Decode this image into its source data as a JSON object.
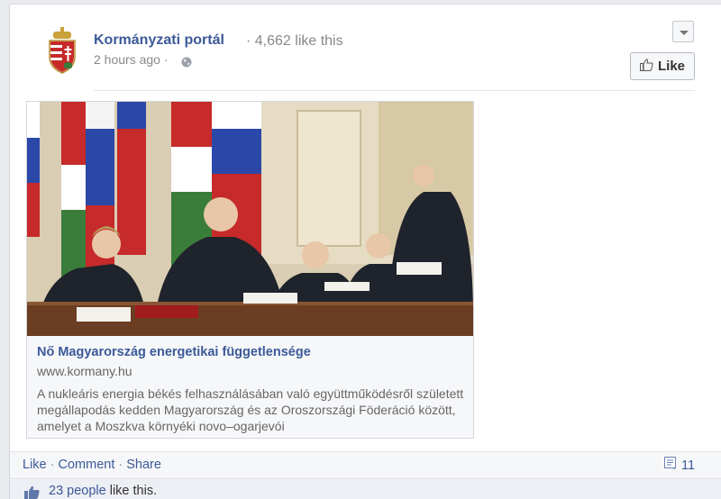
{
  "post": {
    "page_name": "Kormányzati portál",
    "likes_count": "· 4,662 like this",
    "timestamp": "2 hours ago ·",
    "like_button_label": "Like"
  },
  "attachment": {
    "title": "Nő Magyarország energetikai függetlensége",
    "domain": "www.kormany.hu",
    "description": "A nukleáris energia békés felhasználásában való együttműködésről született megállapodás kedden Magyarország és az Oroszországi Föderáció között, amelyet a Moszkva környéki novo–ogarjevói"
  },
  "actions": {
    "like": "Like",
    "comment": "Comment",
    "share": "Share",
    "separator": " · ",
    "comment_count": "11"
  },
  "likers": {
    "people_link": "23 people",
    "suffix": " like this."
  },
  "colors": {
    "link": "#3b5998",
    "muted": "#888888",
    "flag_red": "#c62a2a",
    "flag_green": "#3a7d3a",
    "flag_blue": "#2b48a8"
  },
  "icons": {
    "logo": "hungarian-coat-of-arms-icon",
    "privacy": "globe-icon",
    "like": "thumbs-up-icon",
    "comments": "comment-count-icon",
    "menu": "chevron-down-icon"
  }
}
